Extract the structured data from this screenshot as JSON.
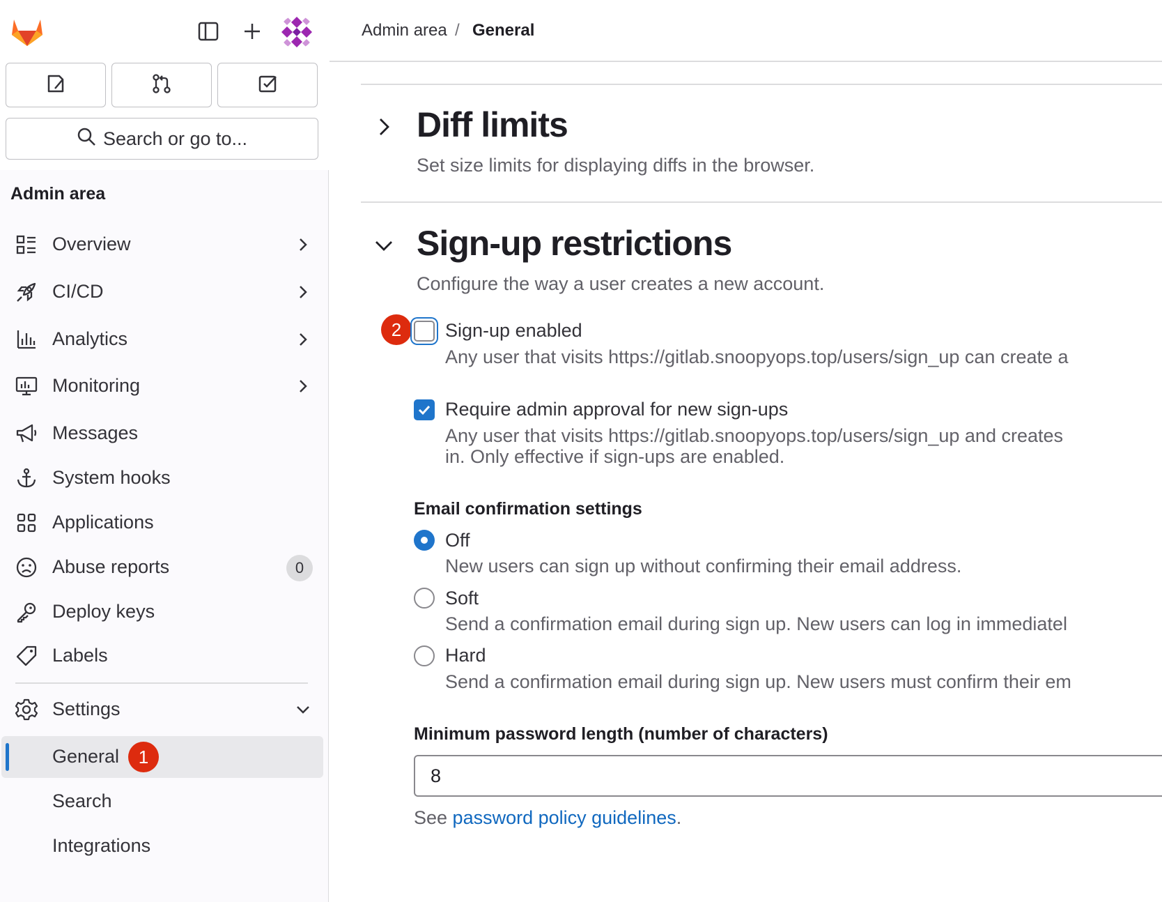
{
  "sidebar": {
    "search_label": "Search or go to...",
    "context_title": "Admin area",
    "nav": [
      {
        "label": "Overview",
        "icon": "overview-icon"
      },
      {
        "label": "CI/CD",
        "icon": "rocket-icon"
      },
      {
        "label": "Analytics",
        "icon": "chart-icon"
      },
      {
        "label": "Monitoring",
        "icon": "monitor-icon"
      },
      {
        "label": "Messages",
        "icon": "megaphone-icon"
      },
      {
        "label": "System hooks",
        "icon": "anchor-icon"
      },
      {
        "label": "Applications",
        "icon": "grid-icon"
      },
      {
        "label": "Abuse reports",
        "icon": "sad-face-icon",
        "badge": "0"
      },
      {
        "label": "Deploy keys",
        "icon": "key-icon"
      },
      {
        "label": "Labels",
        "icon": "label-icon"
      },
      {
        "label": "Settings",
        "icon": "gear-icon"
      }
    ],
    "settings_sub": [
      {
        "label": "General",
        "active": true
      },
      {
        "label": "Search"
      },
      {
        "label": "Integrations"
      }
    ],
    "step_badge_1": "1"
  },
  "breadcrumb": {
    "parent": "Admin area",
    "separator": "/",
    "current": "General"
  },
  "diff_limits": {
    "title": "Diff limits",
    "description": "Set size limits for displaying diffs in the browser."
  },
  "signup": {
    "title": "Sign-up restrictions",
    "description": "Configure the way a user creates a new account.",
    "step_badge_2": "2",
    "signup_enabled": {
      "label": "Sign-up enabled",
      "checked": false,
      "help": "Any user that visits https://gitlab.snoopyops.top/users/sign_up can create a"
    },
    "admin_approval": {
      "label": "Require admin approval for new sign-ups",
      "checked": true,
      "help_line1": "Any user that visits https://gitlab.snoopyops.top/users/sign_up and creates",
      "help_line2": "in. Only effective if sign-ups are enabled."
    },
    "email_confirmation": {
      "label": "Email confirmation settings",
      "selected": "Off",
      "options": [
        {
          "label": "Off",
          "help": "New users can sign up without confirming their email address."
        },
        {
          "label": "Soft",
          "help": "Send a confirmation email during sign up. New users can log in immediatel"
        },
        {
          "label": "Hard",
          "help": "Send a confirmation email during sign up. New users must confirm their em"
        }
      ]
    },
    "min_password": {
      "label": "Minimum password length (number of characters)",
      "value": "8",
      "help_prefix": "See ",
      "help_link": "password policy guidelines",
      "help_suffix": "."
    }
  },
  "colors": {
    "accent": "#1f75cb",
    "badge_red": "#dd2b0e",
    "sidebar_bg": "#fbfafd"
  }
}
